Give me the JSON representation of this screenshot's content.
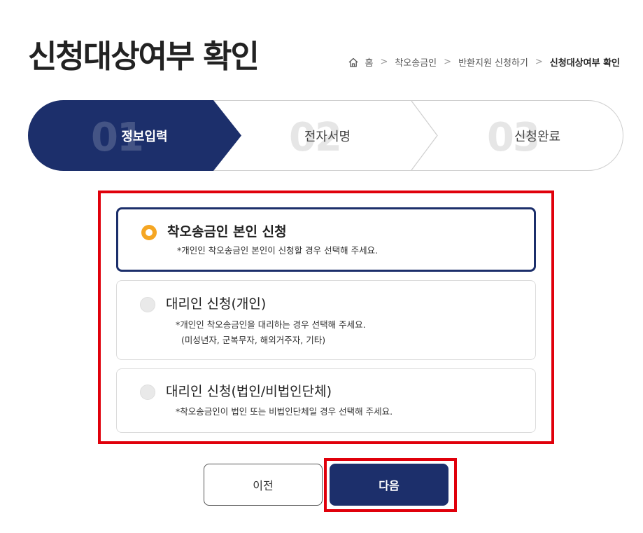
{
  "page": {
    "title": "신청대상여부 확인"
  },
  "breadcrumb": {
    "home_label": "홈",
    "items": [
      "착오송금인",
      "반환지원 신청하기"
    ],
    "current": "신청대상여부 확인"
  },
  "steps": [
    {
      "number": "01",
      "label": "정보입력",
      "state": "active"
    },
    {
      "number": "02",
      "label": "전자서명",
      "state": "inactive"
    },
    {
      "number": "03",
      "label": "신청완료",
      "state": "inactive"
    }
  ],
  "options": [
    {
      "title": "착오송금인 본인 신청",
      "desc_lines": [
        "*개인인 착오송금인 본인이 신청할 경우 선택해 주세요."
      ],
      "selected": true
    },
    {
      "title": "대리인 신청(개인)",
      "desc_lines": [
        "*개인인 착오송금인을 대리하는 경우 선택해 주세요.",
        "(미성년자, 군복무자, 해외거주자, 기타)"
      ],
      "selected": false
    },
    {
      "title": "대리인 신청(법인/비법인단체)",
      "desc_lines": [
        "*착오송금인이 법인 또는 비법인단체일 경우 선택해 주세요."
      ],
      "selected": false
    }
  ],
  "buttons": {
    "prev_label": "이전",
    "next_label": "다음"
  },
  "colors": {
    "primary": "#1c2f6b",
    "accent": "#f5a623",
    "highlight_border": "#e0000b"
  }
}
